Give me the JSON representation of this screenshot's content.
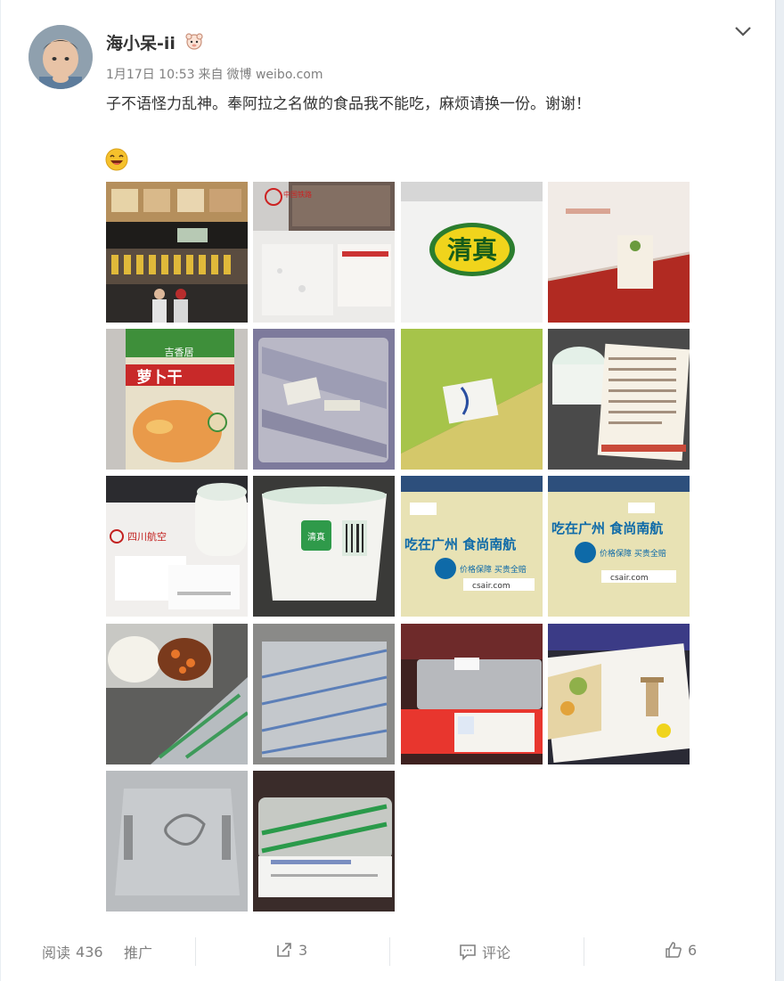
{
  "post": {
    "username": "海小呆-ii",
    "date": "1月17日 10:53",
    "source_prefix": "来自",
    "source": "微博 weibo.com",
    "content": "子不语怪力乱神。奉阿拉之名做的食品我不能吃，麻烦请换一份。谢谢！"
  },
  "photos": {
    "p2_text": "中国铁路",
    "p3_text": "清真",
    "p5_brand": "吉香居",
    "p5_product": "萝卜干",
    "p10_text": "清真",
    "p11_headline": "吃在广州 食尚南航",
    "p11_badge": "价格保障 买贵全赔",
    "p11_url": "csair.com",
    "p12_headline": "吃在广州 食尚南航",
    "p12_badge": "价格保障 买贵全赔",
    "p12_url": "csair.com",
    "p9_airline": "四川航空"
  },
  "footer": {
    "read_label": "阅读",
    "read_count": "436",
    "promote_label": "推广",
    "share_count": "3",
    "comment_label": "评论",
    "like_count": "6"
  },
  "colors": {
    "accent": "#ff8200",
    "text": "#333333",
    "muted": "#808080"
  }
}
